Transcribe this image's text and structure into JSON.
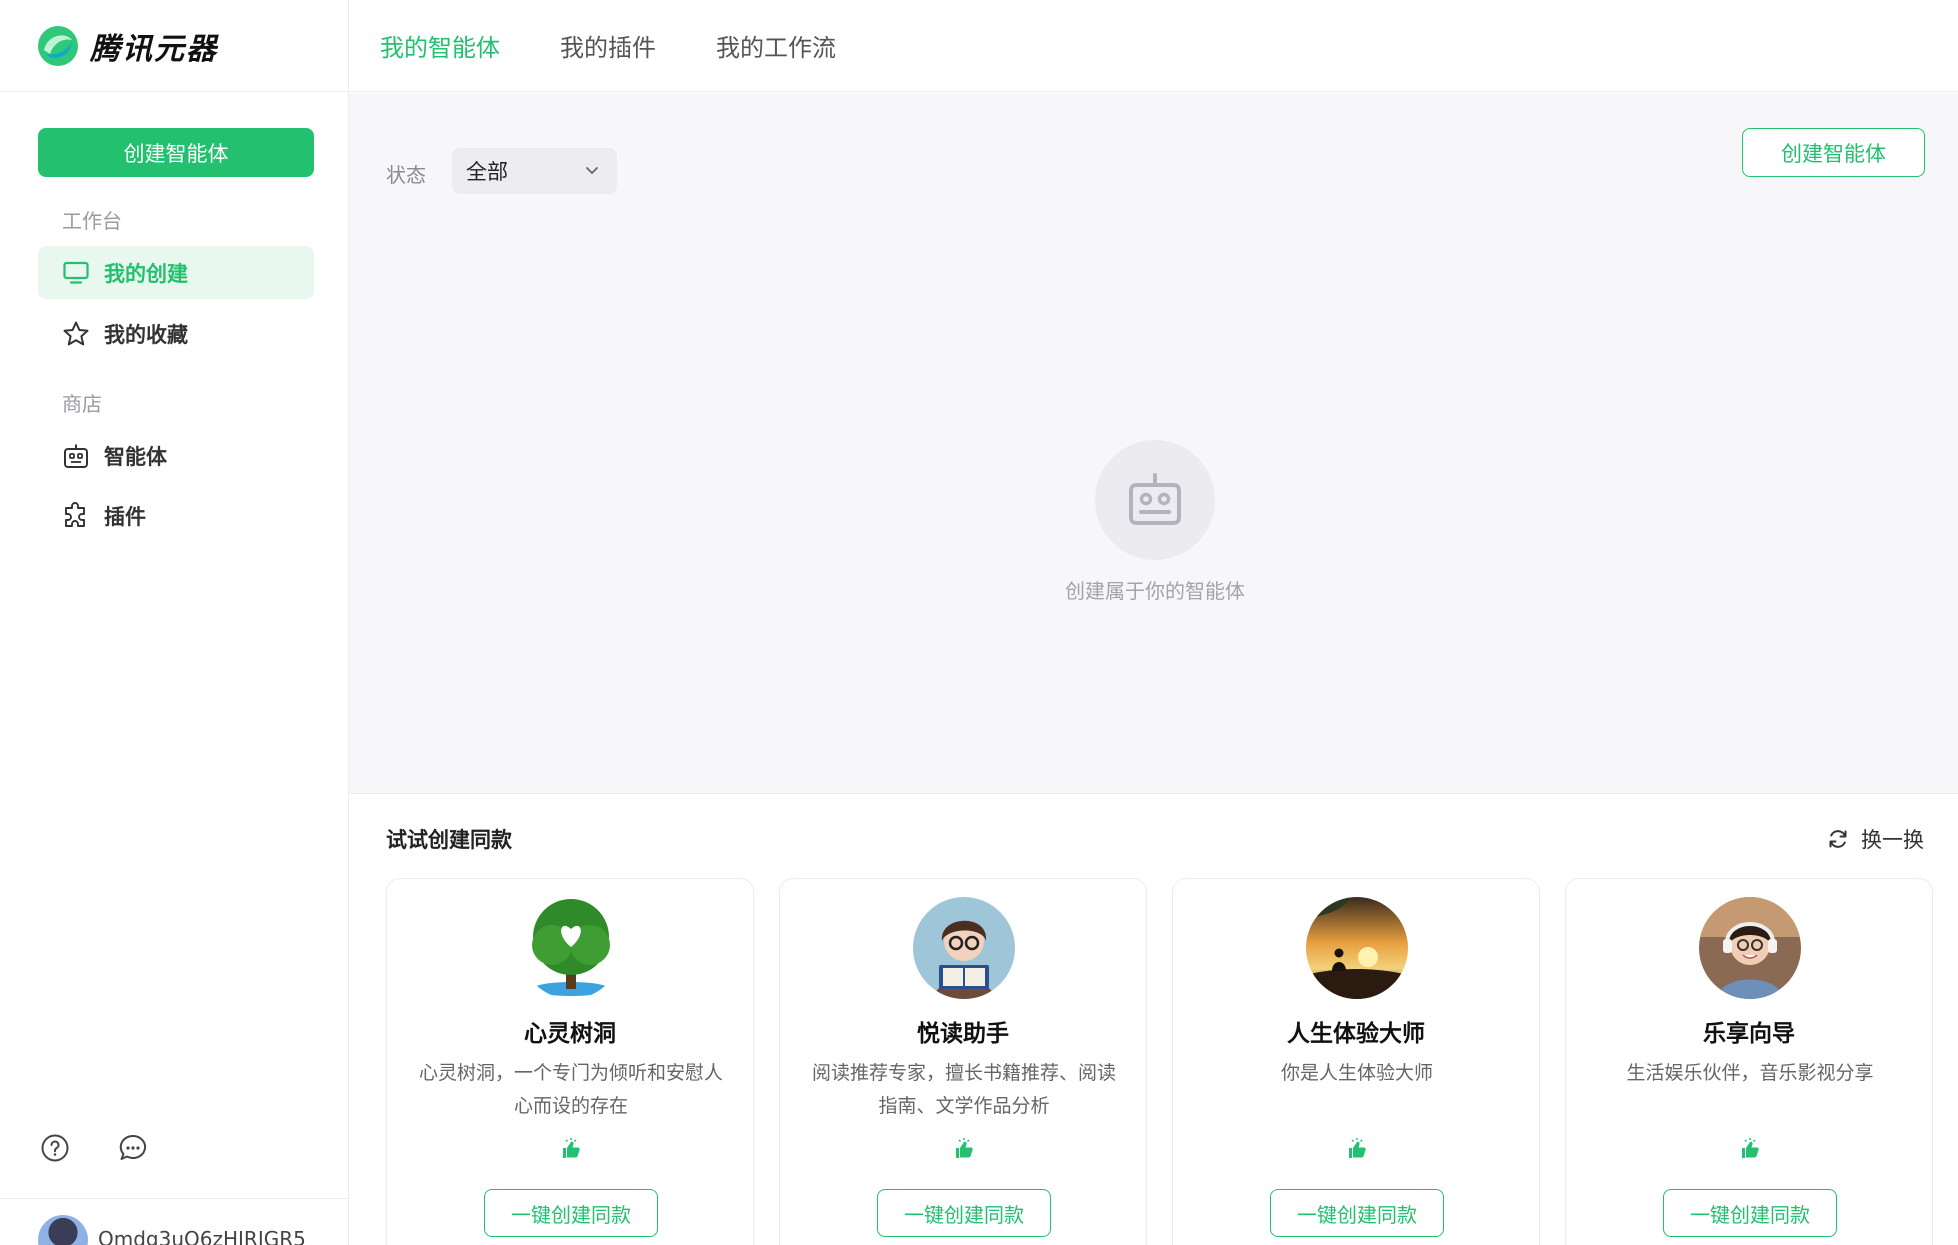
{
  "brand": {
    "name": "腾讯元器"
  },
  "sidebar": {
    "create_label": "创建智能体",
    "workspace_label": "工作台",
    "workspace_items": [
      {
        "label": "我的创建",
        "icon": "monitor-icon",
        "active": true
      },
      {
        "label": "我的收藏",
        "icon": "star-icon",
        "active": false
      }
    ],
    "store_label": "商店",
    "store_items": [
      {
        "label": "智能体",
        "icon": "robot-icon"
      },
      {
        "label": "插件",
        "icon": "puzzle-icon"
      }
    ],
    "footer_icons": [
      "help-icon",
      "feedback-icon"
    ],
    "user": {
      "name": "Omdg3uO6zHIRIGR5"
    }
  },
  "header": {
    "tabs": [
      {
        "label": "我的智能体",
        "active": true
      },
      {
        "label": "我的插件",
        "active": false
      },
      {
        "label": "我的工作流",
        "active": false
      }
    ]
  },
  "main": {
    "filter_label": "状态",
    "filter_value": "全部",
    "create_label": "创建智能体",
    "empty_text": "创建属于你的智能体"
  },
  "suggestions": {
    "title": "试试创建同款",
    "refresh_label": "换一换",
    "cards": [
      {
        "name": "心灵树洞",
        "desc": "心灵树洞，一个专门为倾听和安慰人心而设的存在",
        "button": "一键创建同款"
      },
      {
        "name": "悦读助手",
        "desc": "阅读推荐专家，擅长书籍推荐、阅读指南、文学作品分析",
        "button": "一键创建同款"
      },
      {
        "name": "人生体验大师",
        "desc": "你是人生体验大师",
        "button": "一键创建同款"
      },
      {
        "name": "乐享向导",
        "desc": "生活娱乐伙伴，音乐影视分享",
        "button": "一键创建同款"
      }
    ]
  },
  "colors": {
    "accent": "#22c06f",
    "accent_bg": "#e8f8ee",
    "main_bg": "#f7f7fa"
  }
}
